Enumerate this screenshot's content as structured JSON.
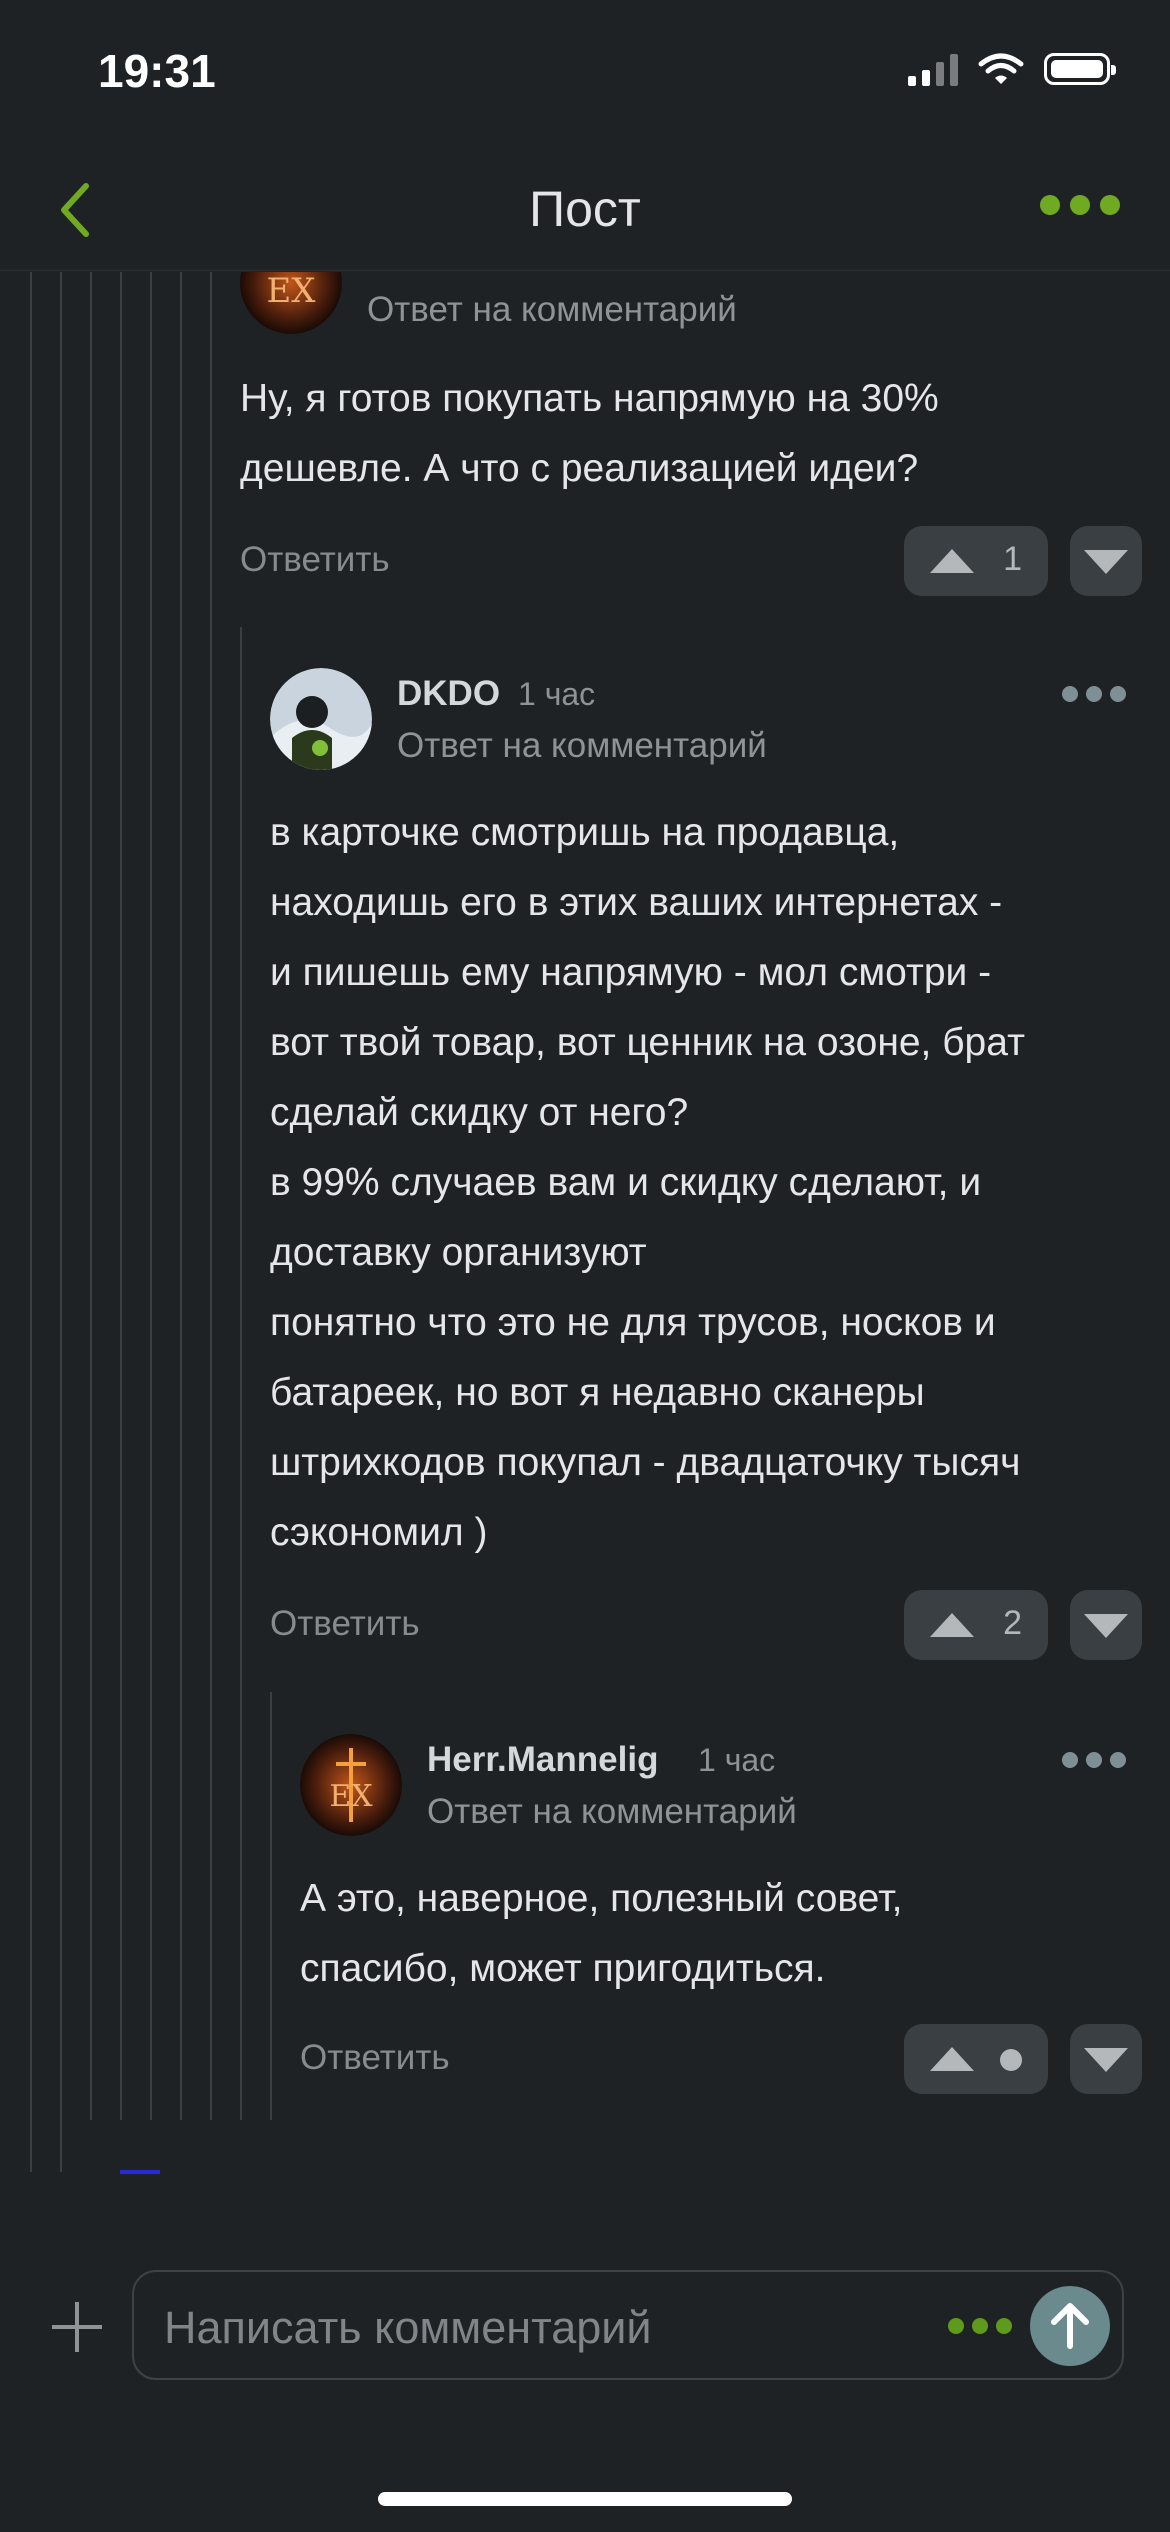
{
  "status_bar": {
    "time": "19:31"
  },
  "navbar": {
    "title": "Пост"
  },
  "comments": [
    {
      "reply_label": "Ответ на комментарий",
      "text": "Ну, я готов покупать напрямую на 30% дешевле. А что с реализацией идеи?",
      "answer_label": "Ответить",
      "votes": "1"
    },
    {
      "author": "DKDO",
      "time": "1 час",
      "reply_label": "Ответ на комментарий",
      "lines": [
        "в карточке смотришь на продавца,",
        "находишь его в этих ваших интернетах -",
        "и пишешь ему напрямую - мол смотри -",
        "вот твой товар, вот ценник на озоне, брат",
        "сделай скидку от него?",
        "в 99% случаев вам и скидку сделают, и",
        "доставку организуют",
        "понятно что это не для трусов, носков и",
        "батареек, но вот я недавно сканеры",
        "штрихкодов покупал - двадцаточку тысяч",
        "сэкономил )"
      ],
      "answer_label": "Ответить",
      "votes": "2"
    },
    {
      "author": "Herr.Mannelig",
      "time": "1 час",
      "reply_label": "Ответ на комментарий",
      "lines": [
        "А это, наверное, полезный совет,",
        "спасибо, может пригодиться."
      ],
      "answer_label": "Ответить"
    }
  ],
  "composer": {
    "placeholder": "Написать комментарий"
  },
  "colors": {
    "background": "#1e2225",
    "accent": "#6faa22",
    "button": "#3a3f43"
  }
}
